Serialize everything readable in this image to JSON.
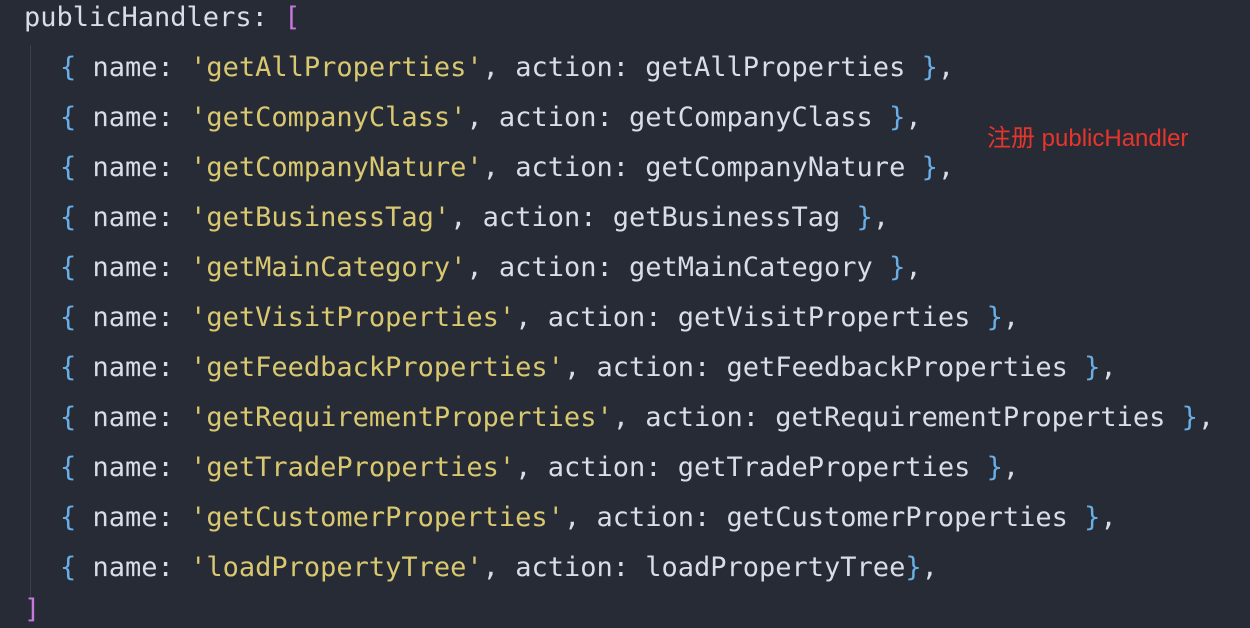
{
  "code": {
    "header_key": "publicHandlers",
    "header_colon": ": ",
    "open_bracket": "[",
    "close_bracket": "]",
    "name_key": "name: ",
    "action_key": "action: ",
    "entries": [
      {
        "name": "'getAllProperties'",
        "action": "getAllProperties",
        "tail": " },"
      },
      {
        "name": "'getCompanyClass'",
        "action": "getCompanyClass",
        "tail": " },"
      },
      {
        "name": "'getCompanyNature'",
        "action": "getCompanyNature",
        "tail": " },"
      },
      {
        "name": "'getBusinessTag'",
        "action": "getBusinessTag",
        "tail": " },"
      },
      {
        "name": "'getMainCategory'",
        "action": "getMainCategory",
        "tail": " },"
      },
      {
        "name": "'getVisitProperties'",
        "action": "getVisitProperties",
        "tail": " },"
      },
      {
        "name": "'getFeedbackProperties'",
        "action": "getFeedbackProperties",
        "tail": " },"
      },
      {
        "name": "'getRequirementProperties'",
        "action": "getRequirementProperties",
        "tail": " },"
      },
      {
        "name": "'getTradeProperties'",
        "action": "getTradeProperties",
        "tail": " },"
      },
      {
        "name": "'getCustomerProperties'",
        "action": "getCustomerProperties",
        "tail": " },"
      },
      {
        "name": "'loadPropertyTree'",
        "action": "loadPropertyTree",
        "tail": "},"
      }
    ]
  },
  "annotation": {
    "text": "注册 publicHandler",
    "color": "#e8352b"
  },
  "colors": {
    "background": "#262b36",
    "string": "#d9c870",
    "brace": "#6aaee6",
    "bracket": "#c678dd",
    "text": "#d8dde6"
  }
}
